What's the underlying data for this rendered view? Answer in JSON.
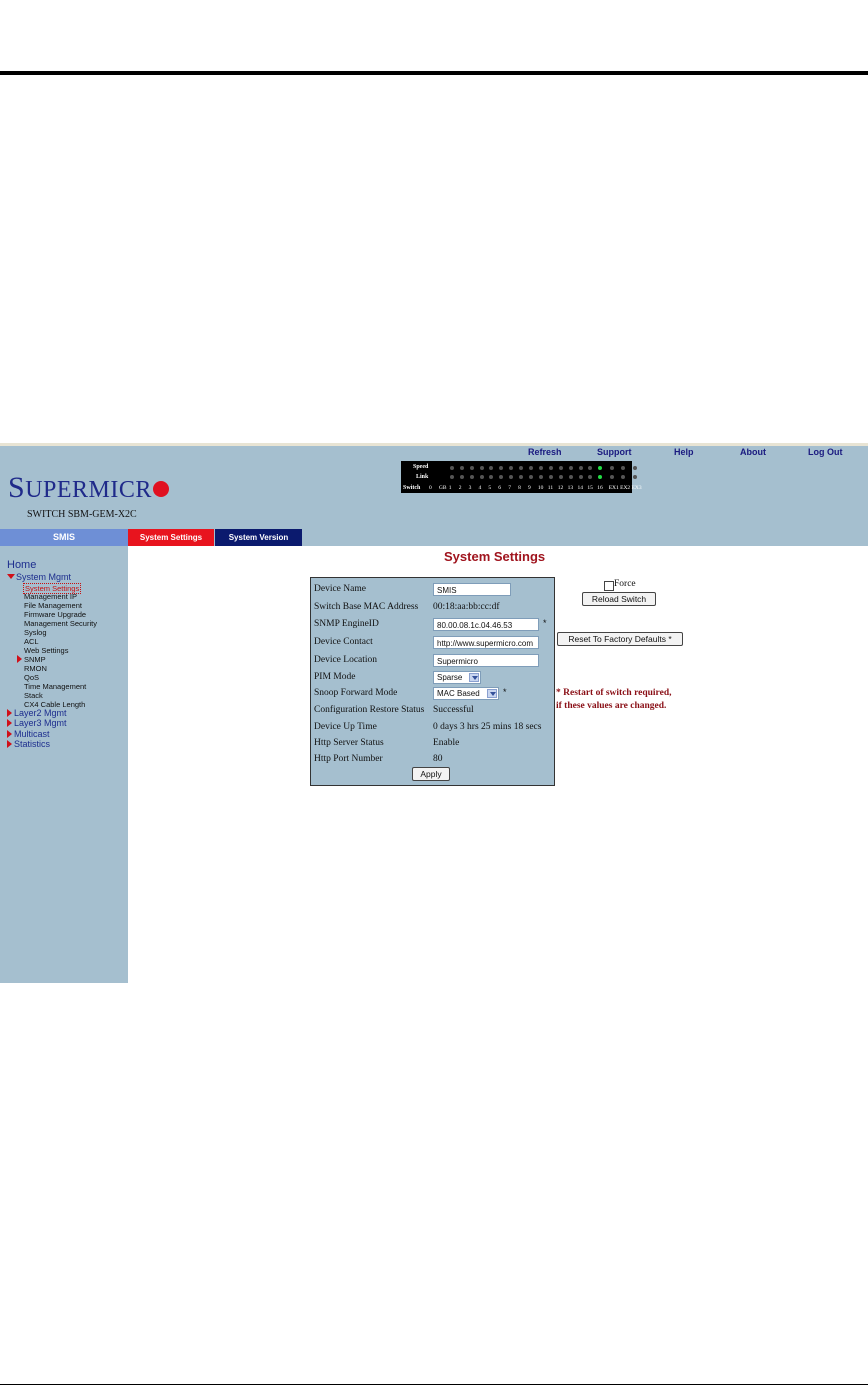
{
  "toplinks": [
    "Refresh",
    "Support",
    "Help",
    "About",
    "Log Out"
  ],
  "logo": {
    "big": "S",
    "rest": "UPERMICR"
  },
  "model": "SWITCH SBM-GEM-X2C",
  "ports": {
    "speed_label": "Speed",
    "link_label": "Link",
    "switch_label": "Switch",
    "numbers": [
      "0",
      "GB",
      "1",
      "2",
      "3",
      "4",
      "5",
      "6",
      "7",
      "8",
      "9",
      "10",
      "11",
      "12",
      "13",
      "14",
      "15",
      "16",
      "EX1",
      "EX2",
      "EX3"
    ],
    "active_port_index": 17,
    "led_on_color": "#22dd44",
    "led_off_color": "#555555"
  },
  "tabs": {
    "smis": "SMIS",
    "settings": "System Settings",
    "version": "System Version"
  },
  "nav": {
    "home": "Home",
    "system_mgmt": "System Mgmt",
    "sub": [
      "System Settings",
      "Management IP",
      "File Management",
      "Firmware Upgrade",
      "Management Security",
      "Syslog",
      "ACL",
      "Web Settings"
    ],
    "snmp": "SNMP",
    "sub2": [
      "RMON",
      "QoS",
      "Time Management",
      "Stack",
      "CX4 Cable Length"
    ],
    "groups": [
      "Layer2 Mgmt",
      "Layer3 Mgmt",
      "Multicast",
      "Statistics"
    ]
  },
  "page_title": "System Settings",
  "form": {
    "device_name_label": "Device Name",
    "device_name_value": "SMIS",
    "mac_label": "Switch Base MAC Address",
    "mac_value": "00:18:aa:bb:cc:df",
    "engine_label": "SNMP EngineID",
    "engine_value": "80.00.08.1c.04.46.53",
    "contact_label": "Device Contact",
    "contact_value": "http://www.supermicro.com",
    "location_label": "Device Location",
    "location_value": "Supermicro",
    "pim_label": "PIM Mode",
    "pim_value": "Sparse",
    "snoop_label": "Snoop Forward Mode",
    "snoop_value": "MAC Based",
    "restore_label": "Configuration Restore Status",
    "restore_value": "Successful",
    "uptime_label": "Device Up Time",
    "uptime_value": "0 days 3 hrs 25 mins 18 secs",
    "http_label": "Http Server Status",
    "http_value": "Enable",
    "port_label": "Http Port Number",
    "port_value": "80",
    "apply": "Apply",
    "star": "*"
  },
  "actions": {
    "force": "Force",
    "reload": "Reload Switch",
    "factory": "Reset To Factory Defaults *"
  },
  "warning": {
    "line1": "* Restart of switch required,",
    "line2": "if these values are changed."
  }
}
